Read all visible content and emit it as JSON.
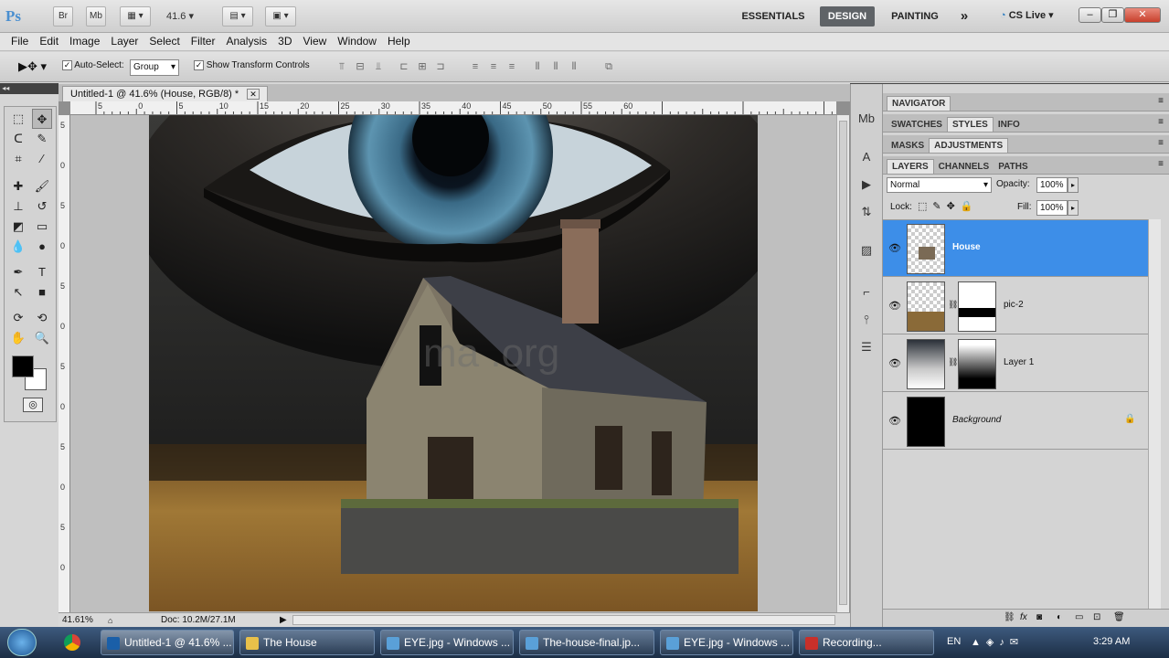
{
  "appbar": {
    "logo": "Ps",
    "bridge_btn": "Br",
    "minibridge_btn": "Mb",
    "zoom_value": "41.6",
    "workspaces": [
      "ESSENTIALS",
      "DESIGN",
      "PAINTING"
    ],
    "more": "»",
    "cslive": "CS Live",
    "win_min": "–",
    "win_restore": "❐",
    "win_close": "✕"
  },
  "menu": [
    "File",
    "Edit",
    "Image",
    "Layer",
    "Select",
    "Filter",
    "Analysis",
    "3D",
    "View",
    "Window",
    "Help"
  ],
  "options": {
    "auto_select_label": "Auto-Select:",
    "auto_select_value": "Group",
    "transform_label": "Show Transform Controls"
  },
  "document": {
    "tab_title": "Untitled-1 @ 41.6% (House, RGB/8) *",
    "zoom_status": "41.61%",
    "doc_size": "Doc: 10.2M/27.1M",
    "ruler_labels": [
      "5",
      "0",
      "5",
      "10",
      "15",
      "20",
      "25",
      "30",
      "35",
      "40",
      "45",
      "50",
      "55",
      "60"
    ],
    "vruler_labels": [
      "5",
      "0",
      "5",
      "0",
      "5",
      "0",
      "5",
      "0",
      "5",
      "0",
      "5",
      "0"
    ],
    "watermark": "ma       .org"
  },
  "panels": {
    "navigator": "NAVIGATOR",
    "group2": [
      "SWATCHES",
      "STYLES",
      "INFO"
    ],
    "group3": [
      "MASKS",
      "ADJUSTMENTS"
    ],
    "group4": [
      "LAYERS",
      "CHANNELS",
      "PATHS"
    ],
    "blend_mode": "Normal",
    "opacity_label": "Opacity:",
    "opacity_value": "100%",
    "lock_label": "Lock:",
    "fill_label": "Fill:",
    "fill_value": "100%",
    "layers": [
      {
        "name": "House",
        "selected": true
      },
      {
        "name": "pic-2",
        "selected": false
      },
      {
        "name": "Layer 1",
        "selected": false
      },
      {
        "name": "Background",
        "selected": false
      }
    ],
    "footer_fx": "fx"
  },
  "taskbar": {
    "items": [
      "Untitled-1 @ 41.6% ...",
      "The House",
      "EYE.jpg - Windows ...",
      "The-house-final.jp...",
      "EYE.jpg - Windows ...",
      "Recording..."
    ],
    "lang": "EN",
    "clock": "3:29 AM"
  },
  "colors": {
    "selection_blue": "#3d8ee8",
    "taskbar": "#25395a"
  }
}
